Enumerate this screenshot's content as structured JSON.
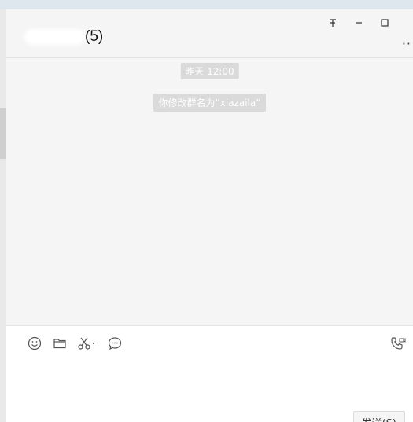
{
  "window_controls": {
    "pin": "ቶ",
    "minimize": "–",
    "maximize": "☐"
  },
  "header": {
    "chat_title_suffix": "(5)",
    "more": "··"
  },
  "messages": [
    {
      "type": "time",
      "text": "昨天 12:00"
    },
    {
      "type": "system",
      "text": "你修改群名为“xiazaila”"
    }
  ],
  "composer": {
    "tools": [
      "emoji-icon",
      "folder-icon",
      "scissors-icon",
      "chat-history-icon"
    ],
    "send_label": "发送(S)"
  },
  "colors": {
    "chat_bg": "#f5f5f5",
    "chip_bg": "#dadada",
    "composer_bg": "#ffffff"
  }
}
